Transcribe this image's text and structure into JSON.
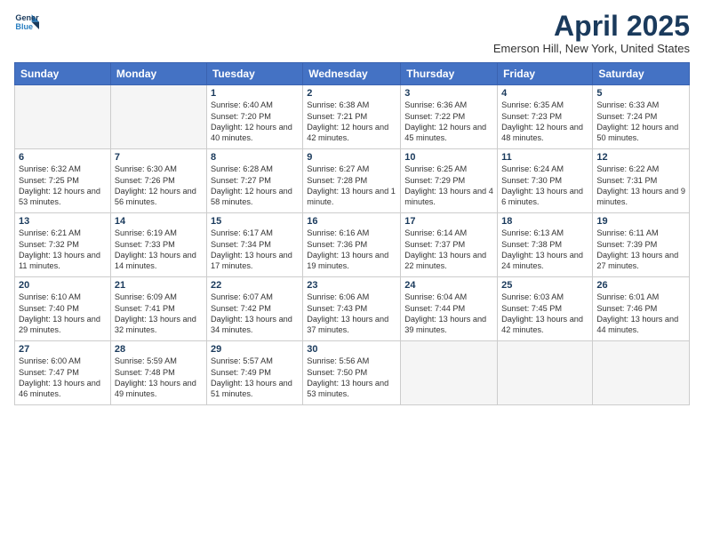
{
  "header": {
    "logo_line1": "General",
    "logo_line2": "Blue",
    "month_title": "April 2025",
    "location": "Emerson Hill, New York, United States"
  },
  "weekdays": [
    "Sunday",
    "Monday",
    "Tuesday",
    "Wednesday",
    "Thursday",
    "Friday",
    "Saturday"
  ],
  "weeks": [
    [
      {
        "num": "",
        "info": ""
      },
      {
        "num": "",
        "info": ""
      },
      {
        "num": "1",
        "info": "Sunrise: 6:40 AM\nSunset: 7:20 PM\nDaylight: 12 hours and 40 minutes."
      },
      {
        "num": "2",
        "info": "Sunrise: 6:38 AM\nSunset: 7:21 PM\nDaylight: 12 hours and 42 minutes."
      },
      {
        "num": "3",
        "info": "Sunrise: 6:36 AM\nSunset: 7:22 PM\nDaylight: 12 hours and 45 minutes."
      },
      {
        "num": "4",
        "info": "Sunrise: 6:35 AM\nSunset: 7:23 PM\nDaylight: 12 hours and 48 minutes."
      },
      {
        "num": "5",
        "info": "Sunrise: 6:33 AM\nSunset: 7:24 PM\nDaylight: 12 hours and 50 minutes."
      }
    ],
    [
      {
        "num": "6",
        "info": "Sunrise: 6:32 AM\nSunset: 7:25 PM\nDaylight: 12 hours and 53 minutes."
      },
      {
        "num": "7",
        "info": "Sunrise: 6:30 AM\nSunset: 7:26 PM\nDaylight: 12 hours and 56 minutes."
      },
      {
        "num": "8",
        "info": "Sunrise: 6:28 AM\nSunset: 7:27 PM\nDaylight: 12 hours and 58 minutes."
      },
      {
        "num": "9",
        "info": "Sunrise: 6:27 AM\nSunset: 7:28 PM\nDaylight: 13 hours and 1 minute."
      },
      {
        "num": "10",
        "info": "Sunrise: 6:25 AM\nSunset: 7:29 PM\nDaylight: 13 hours and 4 minutes."
      },
      {
        "num": "11",
        "info": "Sunrise: 6:24 AM\nSunset: 7:30 PM\nDaylight: 13 hours and 6 minutes."
      },
      {
        "num": "12",
        "info": "Sunrise: 6:22 AM\nSunset: 7:31 PM\nDaylight: 13 hours and 9 minutes."
      }
    ],
    [
      {
        "num": "13",
        "info": "Sunrise: 6:21 AM\nSunset: 7:32 PM\nDaylight: 13 hours and 11 minutes."
      },
      {
        "num": "14",
        "info": "Sunrise: 6:19 AM\nSunset: 7:33 PM\nDaylight: 13 hours and 14 minutes."
      },
      {
        "num": "15",
        "info": "Sunrise: 6:17 AM\nSunset: 7:34 PM\nDaylight: 13 hours and 17 minutes."
      },
      {
        "num": "16",
        "info": "Sunrise: 6:16 AM\nSunset: 7:36 PM\nDaylight: 13 hours and 19 minutes."
      },
      {
        "num": "17",
        "info": "Sunrise: 6:14 AM\nSunset: 7:37 PM\nDaylight: 13 hours and 22 minutes."
      },
      {
        "num": "18",
        "info": "Sunrise: 6:13 AM\nSunset: 7:38 PM\nDaylight: 13 hours and 24 minutes."
      },
      {
        "num": "19",
        "info": "Sunrise: 6:11 AM\nSunset: 7:39 PM\nDaylight: 13 hours and 27 minutes."
      }
    ],
    [
      {
        "num": "20",
        "info": "Sunrise: 6:10 AM\nSunset: 7:40 PM\nDaylight: 13 hours and 29 minutes."
      },
      {
        "num": "21",
        "info": "Sunrise: 6:09 AM\nSunset: 7:41 PM\nDaylight: 13 hours and 32 minutes."
      },
      {
        "num": "22",
        "info": "Sunrise: 6:07 AM\nSunset: 7:42 PM\nDaylight: 13 hours and 34 minutes."
      },
      {
        "num": "23",
        "info": "Sunrise: 6:06 AM\nSunset: 7:43 PM\nDaylight: 13 hours and 37 minutes."
      },
      {
        "num": "24",
        "info": "Sunrise: 6:04 AM\nSunset: 7:44 PM\nDaylight: 13 hours and 39 minutes."
      },
      {
        "num": "25",
        "info": "Sunrise: 6:03 AM\nSunset: 7:45 PM\nDaylight: 13 hours and 42 minutes."
      },
      {
        "num": "26",
        "info": "Sunrise: 6:01 AM\nSunset: 7:46 PM\nDaylight: 13 hours and 44 minutes."
      }
    ],
    [
      {
        "num": "27",
        "info": "Sunrise: 6:00 AM\nSunset: 7:47 PM\nDaylight: 13 hours and 46 minutes."
      },
      {
        "num": "28",
        "info": "Sunrise: 5:59 AM\nSunset: 7:48 PM\nDaylight: 13 hours and 49 minutes."
      },
      {
        "num": "29",
        "info": "Sunrise: 5:57 AM\nSunset: 7:49 PM\nDaylight: 13 hours and 51 minutes."
      },
      {
        "num": "30",
        "info": "Sunrise: 5:56 AM\nSunset: 7:50 PM\nDaylight: 13 hours and 53 minutes."
      },
      {
        "num": "",
        "info": ""
      },
      {
        "num": "",
        "info": ""
      },
      {
        "num": "",
        "info": ""
      }
    ]
  ]
}
